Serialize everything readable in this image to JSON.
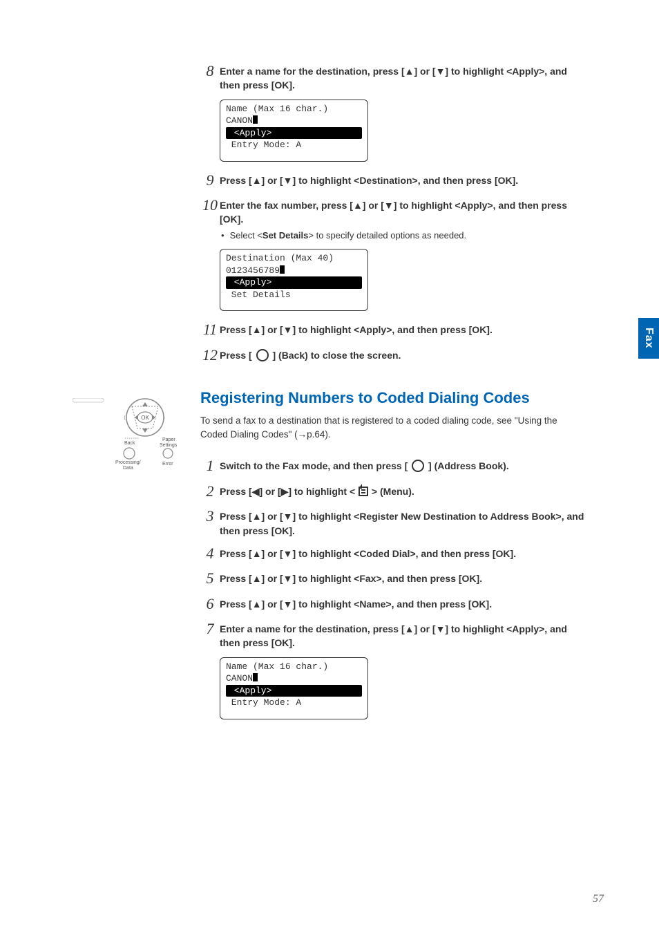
{
  "side_tab": "Fax",
  "page_number": "57",
  "steps_a": [
    {
      "num": "8",
      "text": "Enter a name for the destination, press [▲] or [▼] to highlight <Apply>, and then press [OK].",
      "lcd": {
        "l1": "Name (Max 16 char.)",
        "l2_text": "CANON",
        "hl": " <Apply>",
        "l3": " Entry Mode: A"
      }
    },
    {
      "num": "9",
      "text": "Press [▲] or [▼] to highlight <Destination>, and then press [OK]."
    },
    {
      "num": "10",
      "text": "Enter the fax number, press [▲] or [▼] to highlight <Apply>, and then press [OK].",
      "bullet_prefix": "Select <",
      "bullet_bold": "Set Details",
      "bullet_suffix": "> to specify detailed options as needed.",
      "lcd": {
        "l1": "Destination (Max 40)",
        "l2_text": "0123456789",
        "hl": " <Apply>",
        "l3": " Set Details"
      }
    },
    {
      "num": "11",
      "text": "Press [▲] or [▼] to highlight <Apply>, and then press [OK]."
    },
    {
      "num": "12",
      "text_pre": "Press [ ",
      "text_post": " ] (Back) to close the screen."
    }
  ],
  "section_title": "Registering Numbers to Coded Dialing Codes",
  "section_intro": "To send a fax to a destination that is registered to a coded dialing code, see \"Using the Coded Dialing Codes\" (→p.64).",
  "steps_b": [
    {
      "num": "1",
      "text_pre": "Switch to the Fax mode, and then press [ ",
      "text_post": " ] (Address Book)."
    },
    {
      "num": "2",
      "text_pre": "Press [◀] or [▶] to highlight < ",
      "text_post": " > (Menu)."
    },
    {
      "num": "3",
      "text": "Press [▲] or [▼] to highlight <Register New Destination to Address Book>, and then press [OK]."
    },
    {
      "num": "4",
      "text": "Press [▲] or [▼] to highlight <Coded Dial>, and then press [OK]."
    },
    {
      "num": "5",
      "text": "Press [▲] or [▼] to highlight <Fax>, and then press [OK]."
    },
    {
      "num": "6",
      "text": "Press [▲] or [▼] to highlight <Name>, and then press [OK]."
    },
    {
      "num": "7",
      "text": "Enter a name for the destination, press [▲] or [▼] to highlight <Apply>, and then press [OK].",
      "lcd": {
        "l1": "Name (Max 16 char.)",
        "l2_text": "CANON",
        "hl": " <Apply>",
        "l3": " Entry Mode: A"
      }
    }
  ],
  "dpad": {
    "back": "Back",
    "paper": "Paper\nSettings",
    "proc": "Processing/\nData",
    "err": "Error",
    "ok": "OK"
  }
}
